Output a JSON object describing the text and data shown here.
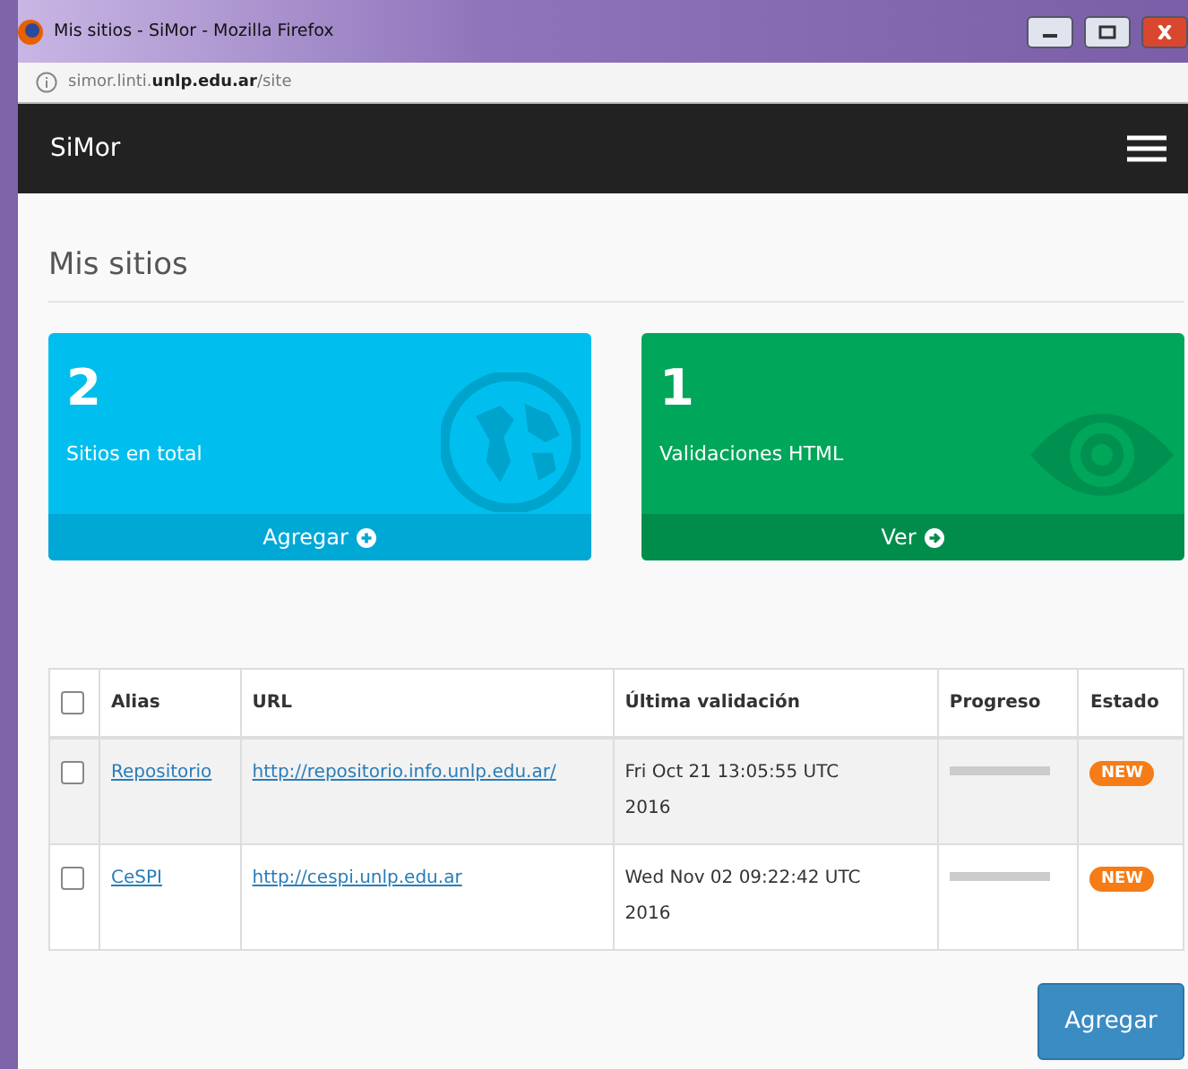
{
  "window": {
    "title": "Mis sitios - SiMor - Mozilla Firefox"
  },
  "address_bar": {
    "prefix": "simor.linti.",
    "domain": "unlp.edu.ar",
    "path": "/site"
  },
  "navbar": {
    "brand": "SiMor"
  },
  "page_title": "Mis sitios",
  "cards": [
    {
      "kind": "sites",
      "count": "2",
      "label": "Sitios en total",
      "action": "Agregar"
    },
    {
      "kind": "validations",
      "count": "1",
      "label": "Validaciones HTML",
      "action": "Ver"
    }
  ],
  "table": {
    "columns": [
      "Alias",
      "URL",
      "Última validación",
      "Progreso",
      "Estado"
    ],
    "header_checked": false,
    "rows": [
      {
        "checked": false,
        "alias": "Repositorio",
        "url": "http://repositorio.info.unlp.edu.ar/",
        "date": "Fri Oct 21 13:05:55 UTC 2016",
        "status": "NEW"
      },
      {
        "checked": false,
        "alias": "CeSPI",
        "url": "http://cespi.unlp.edu.ar",
        "date": "Wed Nov 02 09:22:42 UTC 2016",
        "status": "NEW"
      }
    ]
  },
  "add_button": "Agregar"
}
